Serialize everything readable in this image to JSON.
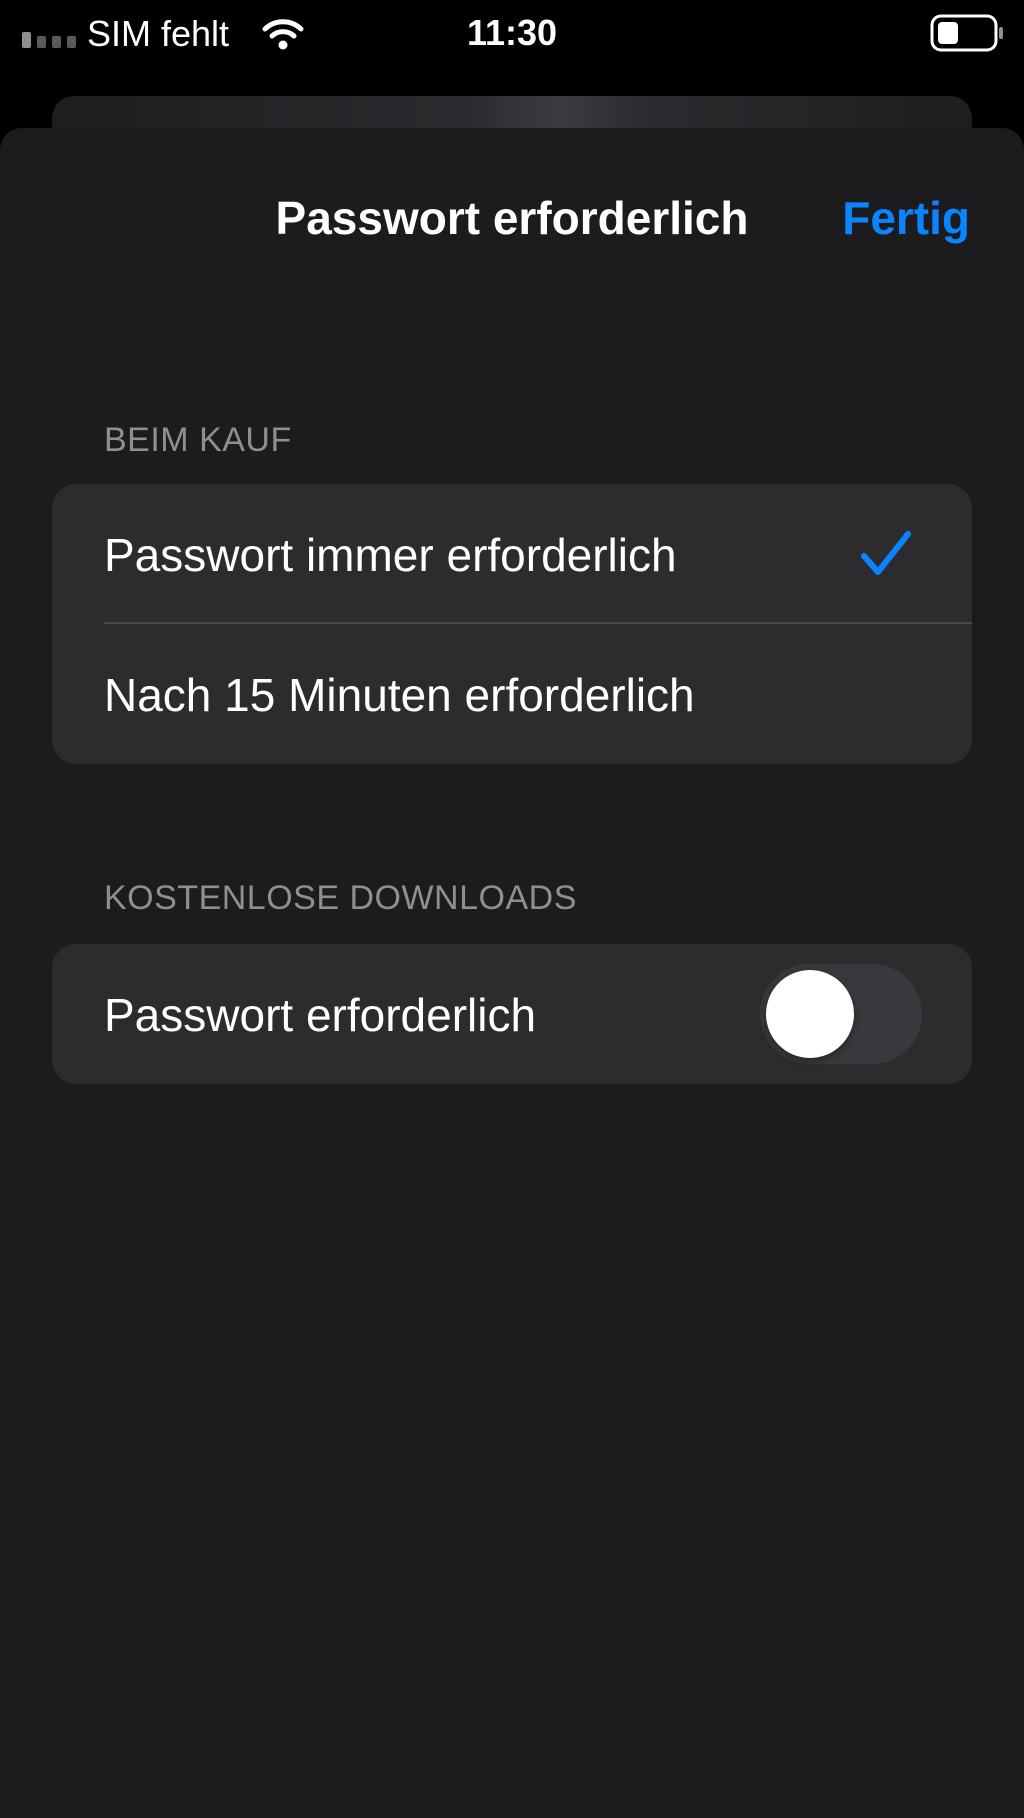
{
  "status_bar": {
    "carrier": "SIM fehlt",
    "time": "11:30",
    "icons": [
      "signal-icon",
      "wifi-icon",
      "battery-icon"
    ]
  },
  "nav": {
    "title": "Passwort erforderlich",
    "done_label": "Fertig"
  },
  "sections": [
    {
      "header": "BEIM KAUF",
      "rows": [
        {
          "label": "Passwort immer erforderlich",
          "selected": true
        },
        {
          "label": "Nach 15 Minuten erforderlich",
          "selected": false
        }
      ]
    },
    {
      "header": "KOSTENLOSE DOWNLOADS",
      "rows": [
        {
          "label": "Passwort erforderlich",
          "toggle_on": false
        }
      ]
    }
  ],
  "colors": {
    "accent": "#0a84ff",
    "background": "#1c1c1e",
    "cell": "#2c2c2e",
    "secondary_text": "#8e8e93"
  }
}
